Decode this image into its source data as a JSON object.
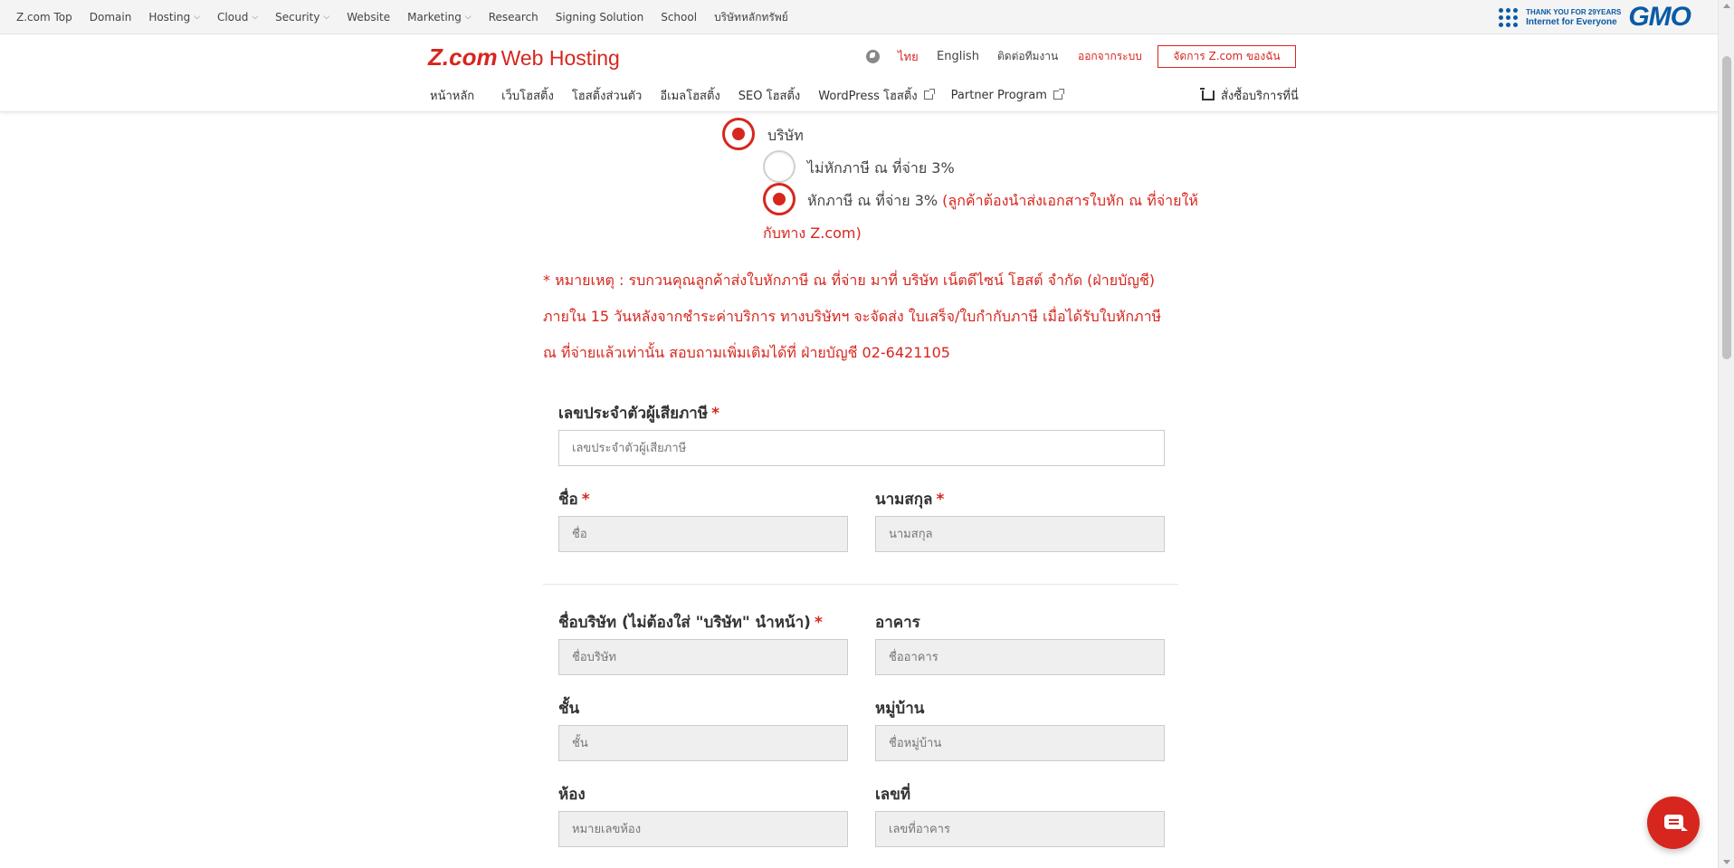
{
  "gmo_bar": {
    "items": [
      {
        "label": "Z.com Top",
        "dropdown": false
      },
      {
        "label": "Domain",
        "dropdown": false
      },
      {
        "label": "Hosting",
        "dropdown": true
      },
      {
        "label": "Cloud",
        "dropdown": true
      },
      {
        "label": "Security",
        "dropdown": true
      },
      {
        "label": "Website",
        "dropdown": false
      },
      {
        "label": "Marketing",
        "dropdown": true
      },
      {
        "label": "Research",
        "dropdown": false
      },
      {
        "label": "Signing Solution",
        "dropdown": false
      },
      {
        "label": "School",
        "dropdown": false
      },
      {
        "label": "บริษัทหลักทรัพย์",
        "dropdown": false
      }
    ],
    "thankyou_line1": "THANK YOU FOR 29YEARS",
    "thankyou_line2": "Internet for Everyone",
    "logo_text": "GMO",
    "brand_color": "#0b5aa6"
  },
  "header": {
    "logo_z": "Z.com",
    "logo_wh": "Web Hosting",
    "lang_thai": "ไทย",
    "lang_english": "English",
    "contact": "ติดต่อทีมงาน",
    "logout": "ออกจากระบบ",
    "manage_button": "จัดการ Z.com ของฉัน",
    "nav": [
      {
        "label": "หน้าหลัก",
        "external": false
      },
      {
        "label": "เว็บโฮสติ้ง",
        "external": false
      },
      {
        "label": "โฮสติ้งส่วนตัว",
        "external": false
      },
      {
        "label": "อีเมลโฮสติ้ง",
        "external": false
      },
      {
        "label": "SEO โฮสติ้ง",
        "external": false
      },
      {
        "label": "WordPress โฮสติ้ง",
        "external": true
      },
      {
        "label": "Partner Program",
        "external": true
      }
    ],
    "order": "สั่งซื้อบริการที่นี่",
    "accent_color": "#d7261e"
  },
  "form": {
    "company_option": "บริษัท",
    "no_withholding": "ไม่หักภาษี ณ ที่จ่าย 3%",
    "withholding": "หักภาษี ณ ที่จ่าย 3%",
    "withholding_note_line1": "(ลูกค้าต้องนำส่งเอกสารใบหัก ณ ที่จ่ายให้",
    "withholding_note_line2": "กับทาง Z.com)",
    "remark": "* หมายเหตุ : รบกวนคุณลูกค้าส่งใบหักภาษี ณ ที่จ่าย มาที่ บริษัท เน็ตดีไซน์ โฮสต์ จำกัด (ฝ่ายบัญชี) ภายใน 15 วันหลังจากชำระค่าบริการ ทางบริษัทฯ จะจัดส่ง ใบเสร็จ/ใบกำกับภาษี เมื่อได้รับใบหักภาษี ณ ที่จ่ายแล้วเท่านั้น สอบถามเพิ่มเติมได้ที่ ฝ่ายบัญชี 02-6421105",
    "required_mark": "*",
    "tax_id_label": "เลขประจำตัวผู้เสียภาษี",
    "tax_id_placeholder": "เลขประจำตัวผู้เสียภาษี",
    "first_name_label": "ชื่อ",
    "first_name_placeholder": "ชื่อ",
    "last_name_label": "นามสกุล",
    "last_name_placeholder": "นามสกุล",
    "company_label": "ชื่อบริษัท (ไม่ต้องใส่ \"บริษัท\" นำหน้า)",
    "company_placeholder": "ชื่อบริษัท",
    "building_label": "อาคาร",
    "building_placeholder": "ชื่ออาคาร",
    "floor_label": "ชั้น",
    "floor_placeholder": "ชั้น",
    "village_label": "หมู่บ้าน",
    "village_placeholder": "ชื่อหมู่บ้าน",
    "room_label": "ห้อง",
    "room_placeholder": "หมายเลขห้อง",
    "number_label": "เลขที่",
    "number_placeholder": "เลขที่อาคาร",
    "company_selected": true,
    "no_withholding_selected": false,
    "withholding_selected": true
  }
}
